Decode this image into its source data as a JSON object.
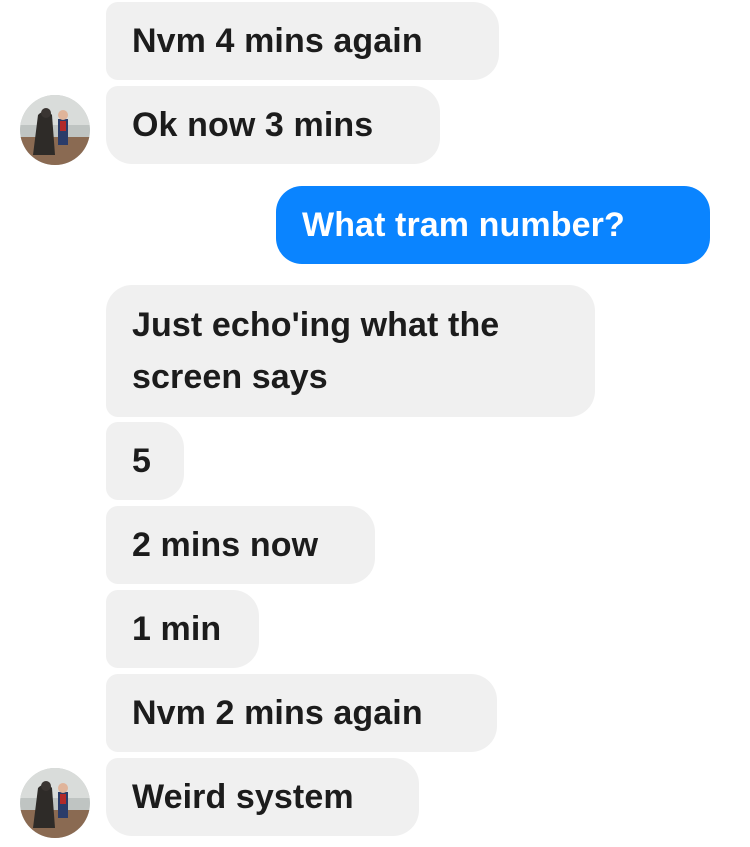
{
  "conversation": {
    "messages": [
      {
        "id": "m1",
        "sender": "them",
        "text": "Nvm 4 mins again"
      },
      {
        "id": "m2",
        "sender": "them",
        "text": "Ok now 3 mins"
      },
      {
        "id": "m3",
        "sender": "me",
        "text": "What tram number?"
      },
      {
        "id": "m4",
        "sender": "them",
        "text": "Just echo'ing what the screen says"
      },
      {
        "id": "m5",
        "sender": "them",
        "text": "5"
      },
      {
        "id": "m6",
        "sender": "them",
        "text": "2 mins now"
      },
      {
        "id": "m7",
        "sender": "them",
        "text": "1 min"
      },
      {
        "id": "m8",
        "sender": "them",
        "text": "Nvm 2 mins again"
      },
      {
        "id": "m9",
        "sender": "them",
        "text": "Weird system"
      }
    ]
  },
  "colors": {
    "incoming_bubble": "#f0f0f0",
    "outgoing_bubble": "#0a84ff",
    "incoming_text": "#1c1c1c",
    "outgoing_text": "#ffffff"
  }
}
